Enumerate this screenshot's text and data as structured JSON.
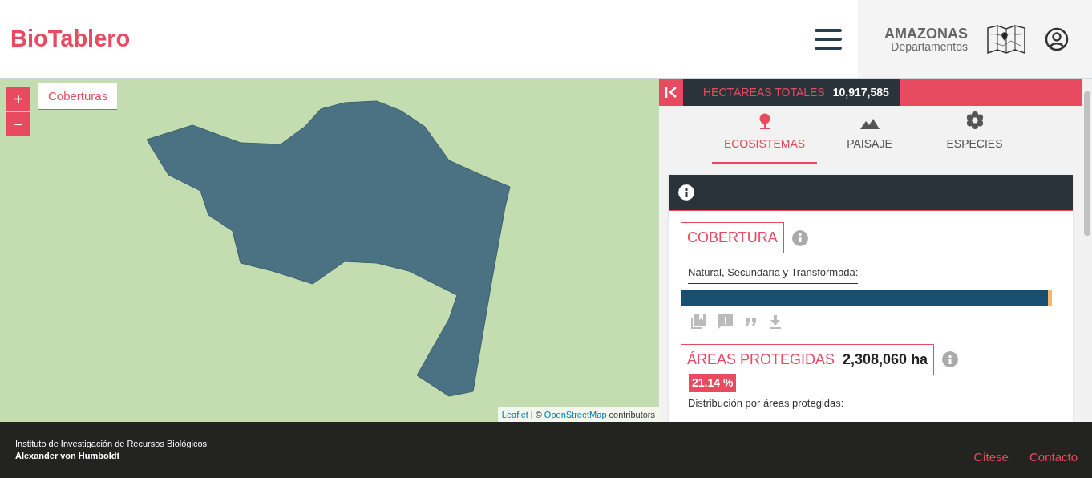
{
  "header": {
    "logo": "BioTablero",
    "region_name": "AMAZONAS",
    "region_type": "Departamentos"
  },
  "map": {
    "zoom_in": "+",
    "zoom_out": "−",
    "layer_button": "Coberturas",
    "attribution": [
      {
        "kind": "link",
        "text": "Leaflet"
      },
      {
        "kind": "text",
        "text": "| ©"
      },
      {
        "kind": "link",
        "text": "OpenStreetMap"
      },
      {
        "kind": "text",
        "text": "contributors"
      }
    ]
  },
  "panel": {
    "total_label": "HECTÁREAS TOTALES",
    "total_value": "10,917,585",
    "tabs": [
      {
        "label": "ECOSISTEMAS",
        "kind": "tree",
        "selected": true
      },
      {
        "label": "PAISAJE",
        "kind": "mountain",
        "selected": false
      },
      {
        "label": "ESPECIES",
        "kind": "flower",
        "selected": false
      }
    ],
    "coverage": {
      "title": "COBERTURA",
      "legend": "Natural, Secundaria y Transformada:",
      "level": 0.99
    },
    "protected": {
      "title": "ÁREAS PROTEGIDAS",
      "value": "2,308,060 ha",
      "percent": "21.14 %",
      "subtitle": "Distribución por áreas protegidas:"
    }
  },
  "footer": {
    "institute": "Instituto de Investigación de Recursos Biológicos",
    "institute_name": "Alexander von Humboldt",
    "links": [
      "Cítese",
      "Contacto"
    ]
  }
}
